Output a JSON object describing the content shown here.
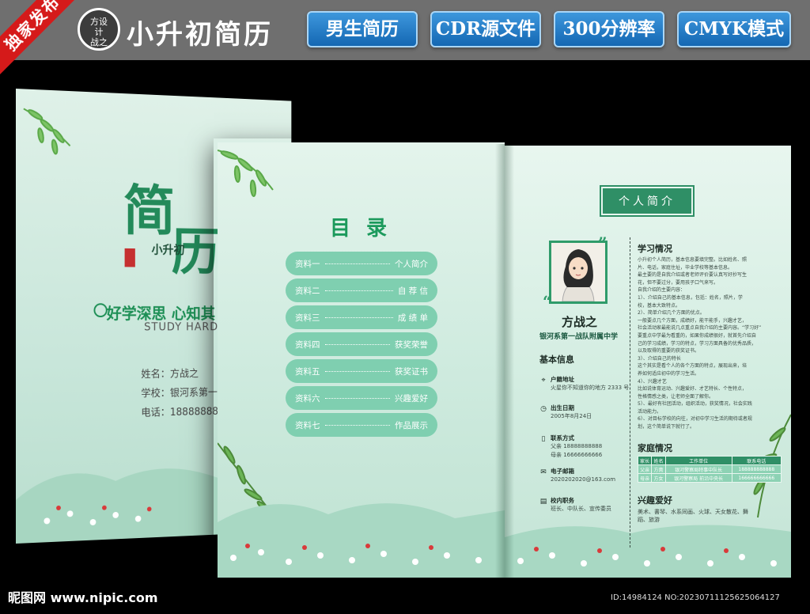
{
  "header": {
    "ribbon": "独家发布",
    "logo_lines": [
      "方设",
      "计",
      "战之"
    ],
    "title": "小升初简历",
    "tags": [
      "男生简历",
      "CDR源文件",
      "300分辨率",
      "CMYK模式"
    ]
  },
  "cover": {
    "big_char_1": "简",
    "big_char_2": "历",
    "small_title": "小升初",
    "slogan": "好学深思  心知其",
    "english": "STUDY HARD",
    "info": [
      {
        "label": "姓名：",
        "value": "方战之"
      },
      {
        "label": "学校：",
        "value": "银河系第一战"
      },
      {
        "label": "电话：",
        "value": "18888888"
      }
    ]
  },
  "toc": {
    "title": "目录",
    "items": [
      {
        "left": "资料一",
        "right": "个人简介"
      },
      {
        "left": "资料二",
        "right": "自 荐 信"
      },
      {
        "left": "资料三",
        "right": "成 绩 单"
      },
      {
        "left": "资料四",
        "right": "获奖荣誉"
      },
      {
        "left": "资料五",
        "right": "获奖证书"
      },
      {
        "left": "资料六",
        "right": "兴趣爱好"
      },
      {
        "left": "资料七",
        "right": "作品展示"
      }
    ]
  },
  "profile": {
    "banner": "个人简介",
    "name": "方战之",
    "school": "银河系第一战队附属中学",
    "basic_info_title": "基本信息",
    "fields": [
      {
        "icon": "location-icon",
        "label": "户籍地址",
        "lines": [
          "火星你不知道你的地方 2333 号"
        ]
      },
      {
        "icon": "clock-icon",
        "label": "出生日期",
        "lines": [
          "2005年8月24日"
        ]
      },
      {
        "icon": "phone-icon",
        "label": "联系方式",
        "lines": [
          "父亲    18888888888",
          "母亲    16666666666"
        ]
      },
      {
        "icon": "mail-icon",
        "label": "电子邮箱",
        "lines": [
          "2020202020@163.com"
        ]
      },
      {
        "icon": "briefcase-icon",
        "label": "校内职务",
        "lines": [
          "班长、中队长、宣传委员"
        ]
      }
    ],
    "study_title": "学习情况",
    "study_lines": [
      "小升初个人简历，基本信息要填完整。比如姓名、照",
      "片、电话，家庭住址，毕业学校等基本信息。",
      "最主要的是自我介绍或者老师评价要认真写好抄写生",
      "花，但不要过分，要用孩子口气来写。",
      "自我介绍的主要内容：",
      "1）、介绍自己的基本信息，包括：姓名，照片，学",
      "校，基本大致特点。",
      "2）、简单介绍几个方面的优点。",
      "一般要点几个方面，成绩好，能干能手，兴趣才艺，",
      "社会活动家最能说几点重点自我介绍的主要内容。“学习好”",
      "要重点中学最为看重的，如果你成绩很好，就首先介绍自",
      "己的学习成绩，学习的特点，学习方面具备的优秀品质，",
      "以及取得的重要的获奖证书。",
      "3）、介绍自己的特长",
      "这个其实是看个人的各个方面的特点，展现出来，培",
      "养如何适应初中的学习生活。",
      "4）、兴趣才艺",
      "比如说体育运动、兴趣爱好、才艺特长、个性特点，",
      "性格情感之类，让老师全面了解你。",
      "5）、最好有社团活动，组织活动，获奖情况，社会实践",
      "活动能力。",
      "6）、对目标学校的向往，对初中学习生活的期待或者规",
      "划，这个简单说下就行了。"
    ],
    "family_title": "家庭情况",
    "family_headers": [
      "家长",
      "姓名",
      "工作单位",
      "联系电话"
    ],
    "family_rows": [
      [
        "父亲",
        "方斋",
        "银河警察局特事中队长",
        "188888888888"
      ],
      [
        "母亲",
        "方女",
        "银河警察局 前沿中央长",
        "166666666666"
      ]
    ],
    "hobby_title": "兴趣爱好",
    "hobby_text": "美术、書琴、水系同画、火球、天女散花、舞蹈、旅游"
  },
  "watermark": {
    "left": "昵图网 www.nipic.com",
    "right": "ID:14984124 NO:20230711125625064127"
  }
}
